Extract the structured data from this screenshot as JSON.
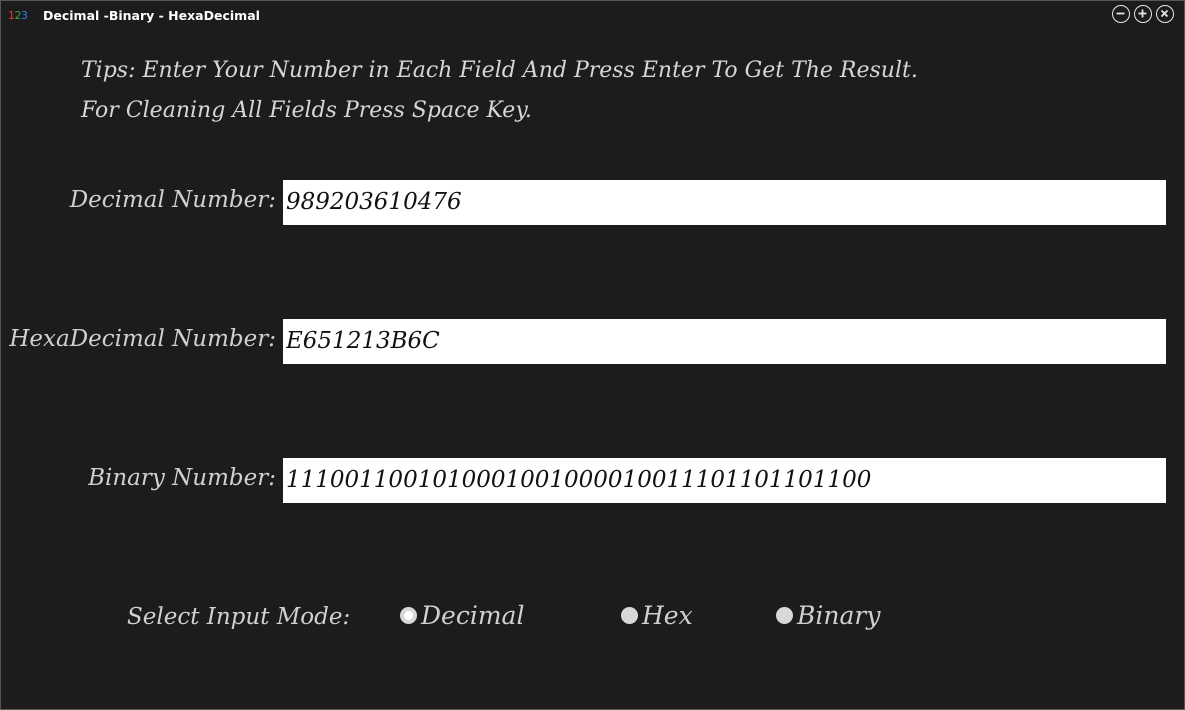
{
  "window": {
    "title": "Decimal -Binary - HexaDecimal",
    "icon_digits": [
      "1",
      "2",
      "3"
    ],
    "controls": [
      "minimize-icon",
      "maximize-icon",
      "close-icon"
    ]
  },
  "tips": {
    "line1": "Tips: Enter Your Number in Each Field And Press Enter To Get The Result.",
    "line2": "For Cleaning All Fields Press Space Key."
  },
  "fields": {
    "decimal": {
      "label": "Decimal Number:",
      "value": "989203610476"
    },
    "hex": {
      "label": "HexaDecimal Number:",
      "value": "E651213B6C"
    },
    "binary": {
      "label": "Binary Number:",
      "value": "1110011001010001001000010011101101101100"
    }
  },
  "input_mode": {
    "label": "Select Input Mode:",
    "options": [
      "Decimal",
      "Hex",
      "Binary"
    ],
    "selected": "Decimal"
  },
  "colors": {
    "background": "#1c1c1c",
    "text": "#d0d0d0",
    "field_bg": "#ffffff"
  }
}
